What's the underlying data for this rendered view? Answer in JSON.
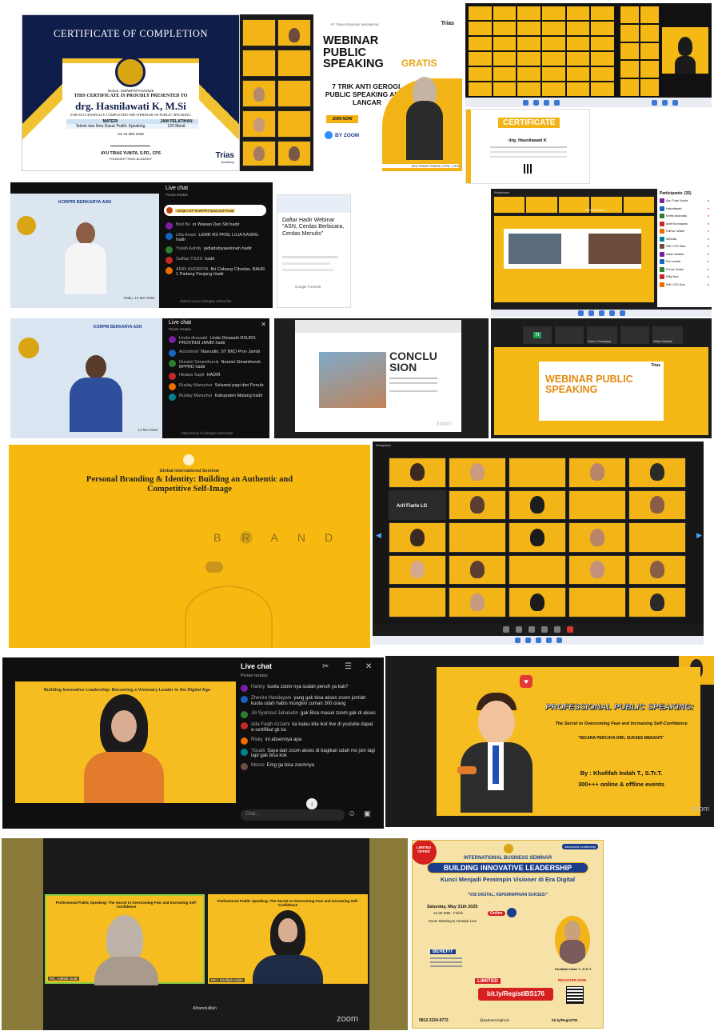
{
  "certificate": {
    "title": "CERTIFICATE OF COMPLETION",
    "number": "Nomor: 029/WPS/TA/V/2025",
    "presented": "THIS CERTIFICATE IS PROUDLY PRESENTED TO",
    "name": "drg. Hasnilawati K, M.Si",
    "completed": "FOR SUCCESSFULLY COMPLETED THE WEBINAR OF PUBLIC SPEAKING",
    "table_headers": [
      "MATERI",
      "JAM PELATIHAN"
    ],
    "table_row": [
      "Teknik dan Ilmu Dasar Public Speaking",
      "120 Menit"
    ],
    "date": "On 22 MEI 2025",
    "signer": "AYU TRIAS YUNITA, S.PD., CPS",
    "signer_role": "FOUNDER TRIAS ACADEMY",
    "brand": "Trias",
    "brand_sub": "Academy"
  },
  "poster_public_speaking": {
    "org": "PT TRIAS EDUKASI INDONESIA",
    "title": "WEBINAR PUBLIC SPEAKING",
    "badge": "GRATIS",
    "subtitle": "7 TRIK ANTI GEROGI, PUBLIC SPEAKING AUTO LANCAR",
    "cta": "JOIN NOW",
    "via": "BY ZOOM",
    "speaker": "AYU TRIAS YUNITA, S.PD., CPS",
    "brand": "Trias"
  },
  "certificate_small": {
    "title": "CERTIFICATE",
    "name": "drg. Hasnilawati K"
  },
  "youtube_live_1": {
    "chat_title": "Live chat",
    "chat_sub": "Pesan teratas",
    "pinned": "Sekjen GP KORPRI Nasional Pusat",
    "banner": "KORPRI BERKARYA ASN",
    "date": "Rabu, 14 Mei 2025",
    "messages": [
      {
        "name": "Bod Be",
        "text": "in Wawan Dan Siti hadir"
      },
      {
        "name": "Lilia Anam",
        "text": "LEMR RS PKNL LILIA KASRIL hadir"
      },
      {
        "name": "Yuliah Aahdy",
        "text": "jadiadubiyaadonah hadir"
      },
      {
        "name": "Sulfian TSJIS",
        "text": "hadir"
      },
      {
        "name": "ADIN KHOIRIYA",
        "text": "Bri Cabang Cibodas, BAHR 1 Padang Panjang Hadir"
      }
    ],
    "footer": "Mulai trosa ini dengan subscribe"
  },
  "form_card": {
    "title": "Daftar Hadir Webinar \"ASN, Cerdas Berbicara, Cerdas Menulis\"",
    "footer": "Google Formulir"
  },
  "zoom_presentation": {
    "app": "Workplace",
    "participants_title": "Participants",
    "participants_count": "(35)",
    "participants": [
      "Ayu Trias Yunita",
      "Hasnilawati",
      "Kefira Anandita",
      "Arief Kurniawan",
      "Fatma Yuliani",
      "Melinda",
      "WiK LGS Satu",
      "Indah Amalia",
      "Rio Lestari",
      "Fenny Vivian",
      "Rifqi Hari",
      "WiK LGS Dua"
    ],
    "presenter": "PRIMA APRIL..."
  },
  "youtube_live_2": {
    "chat_title": "Live chat",
    "chat_sub": "Pesan teratas",
    "banner": "KORPRI BERKARYA ASN",
    "date": "14 Mei 2025",
    "messages": [
      {
        "name": "Linda dinasabi",
        "text": "Linda Dinasabi RSURS PROVINSI JAMBI hadir"
      },
      {
        "name": "Azizahnaf",
        "text": "Nasrudin, ST BKD Prov Jambi"
      },
      {
        "name": "Nuraini Simanihuruk",
        "text": "Nuraini Simanihuruk BPPRD hadir"
      },
      {
        "name": "Hinasa Saptt",
        "text": "HADIR"
      },
      {
        "name": "Ruslay Marsuhur",
        "text": "Selamat pagi dari Penuls"
      },
      {
        "name": "Ruslay Marsuhur",
        "text": "Kabupaten Malang hadir"
      }
    ],
    "footer": "Mulai trosa ini dengan subscribe"
  },
  "conclusion_slide": {
    "title": "CONCLU SION",
    "watermark": "zoom"
  },
  "zoom_webinar_slide": {
    "title": "WEBINAR PUBLIC SPEAKING",
    "brand": "Trias",
    "participants": [
      "N",
      "Dewi | Surabaya",
      "Wiha Sutadiu"
    ]
  },
  "brand_slide": {
    "overline": "Global International Seminar",
    "title": "Personal Branding & Identity: Building an Authentic and Competitive Self-Image",
    "letters": [
      "B",
      "R",
      "A",
      "N",
      "D"
    ]
  },
  "zoom_gallery": {
    "app": "Workplace",
    "named_tile": "Arif Fiarlo LG"
  },
  "youtube_live_3": {
    "chat_title": "Live chat",
    "chat_sub": "Pesan teratas",
    "slide_title": "Building Innovative Leadership: Becoming a Visionary Leader in the Digital Age",
    "messages": [
      {
        "name": "Hanny",
        "text": "kuota zoom nya sudah penuh ya kak?"
      },
      {
        "name": "Zhevira Handayani",
        "text": "yang gak bisa akses zoom jumlah kuota udah habis mungkin cuman 300 orang"
      },
      {
        "name": "Jili Syamsul Jahaludin",
        "text": "gak Bisa masuk zoom gak di akses"
      },
      {
        "name": "Ada Faqih Azzami",
        "text": "ka kalau kita ikut live di youtube dapat e-sertifikat gk ka"
      },
      {
        "name": "Risky",
        "text": "ini absennya apa"
      },
      {
        "name": "Yosaili",
        "text": "Saya dari zoom akses di bagikan udah ms join lagi tapi gak bisa kok"
      },
      {
        "name": "Merco",
        "text": "Emg ga bisa zoomnya"
      }
    ],
    "input_placeholder": "Chat..."
  },
  "pps_slide": {
    "title": "PROFESSIONAL PUBLIC SPEAKING:",
    "subtitle": "The Secret to Overcoming Fear and Increasing Self-Confidence",
    "tagline": "\"BICARA PERCAYA DIRI, SUKSES MENANTI\"",
    "by": "By : Khofifah Indah T., S.Tr.T.",
    "stats": "300+++ online & offline events",
    "watermark": "zoom"
  },
  "zoom_two": {
    "slide_title": "Professional Public Speaking: The Secret to Overcoming Fear and Increasing Self-Confidence",
    "left_name": "MC_Adinda Jouki",
    "right_name": "MC | Khofifah Indah",
    "caption": "Alhamdulillah",
    "watermark": "zoom"
  },
  "ibs_poster": {
    "ribbon": "LIMITED OFFER",
    "tag": "Advanced Leadership",
    "overline": "INTERNATIONAL BUSINESS SEMINAR",
    "title": "BUILDING INNOVATIVE LEADERSHIP",
    "subtitle": "Kunci Menjadi Pemimpin Visioner di Era Digital",
    "quote": "\"VISI DIGITAL, KEPEMIMPINAN SUKSES!\"",
    "date": "Saturday, May 31th 2025",
    "time": "13.30 WIB - Finish",
    "mode": "Online",
    "platform": "Zoom Meeting & Youtube Live",
    "benefit": "BENEFIT",
    "limited": "LIMITED",
    "link": "bit.ly/RegistIBS176",
    "register": "REGISTER NOW",
    "contact_phone": "0812-3224-9772",
    "contact_ig": "@partnerinsight.id",
    "contact_link": "bit.ly/RegistTM",
    "speaker": "Khofifah Indah T., S.Tr.T."
  }
}
